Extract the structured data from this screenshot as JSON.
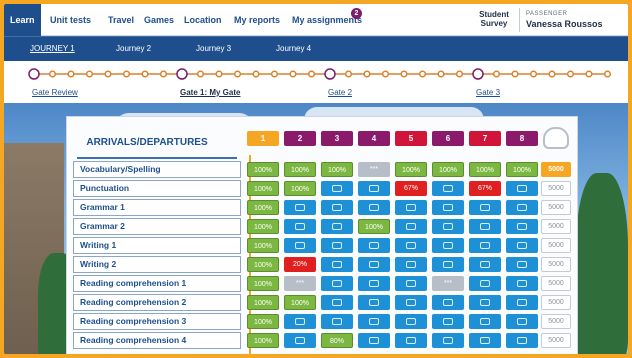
{
  "nav": {
    "tabs": [
      "Learn",
      "Unit tests",
      "Travel",
      "Games",
      "Location",
      "My reports",
      "My assignments"
    ],
    "assignments_badge": "2",
    "survey": "Student Survey",
    "passenger_label": "PASSENGER",
    "passenger_name": "Vanessa Roussos"
  },
  "journeys": [
    "JOURNEY 1",
    "Journey 2",
    "Journey 3",
    "Journey 4"
  ],
  "gates": {
    "review": "Gate Review",
    "g1": "Gate 1: My Gate",
    "g2": "Gate 2",
    "g3": "Gate 3"
  },
  "board": {
    "header": "ARRIVALS/DEPARTURES",
    "gate_numbers": [
      "1",
      "2",
      "3",
      "4",
      "5",
      "6",
      "7",
      "8"
    ],
    "gate_colors": [
      "#f5a623",
      "#8b1a6b",
      "#8b1a6b",
      "#8b1a6b",
      "#d1153a",
      "#8b1a6b",
      "#d1153a",
      "#8b1a6b"
    ],
    "rows": [
      {
        "label": "Vocabulary/Spelling",
        "cells": [
          "100%",
          "100%",
          "100%",
          "***",
          "100%",
          "100%",
          "100%",
          "100%"
        ],
        "score": "5000"
      },
      {
        "label": "Punctuation",
        "cells": [
          "100%",
          "100%",
          "plane",
          "bike",
          "67%",
          "card",
          "67%",
          "bag"
        ],
        "score": "5000"
      },
      {
        "label": "Grammar 1",
        "cells": [
          "100%",
          "wheel",
          "ticket",
          "camera",
          "bed",
          "food",
          "map",
          "shoe"
        ],
        "score": "5000"
      },
      {
        "label": "Grammar 2",
        "cells": [
          "100%",
          "bus",
          "tree",
          "100%",
          "star",
          "cake",
          "boat",
          "hand"
        ],
        "score": "5000"
      },
      {
        "label": "Writing 1",
        "cells": [
          "100%",
          "truck",
          "sign",
          "face",
          "ball",
          "hat",
          "moon",
          "cup"
        ],
        "score": "5000"
      },
      {
        "label": "Writing 2",
        "cells": [
          "100%",
          "20%",
          "car",
          "ship",
          "sail",
          "brush",
          "kite",
          "pin"
        ],
        "score": "5000"
      },
      {
        "label": "Reading comprehension 1",
        "cells": [
          "100%",
          "***",
          "drop",
          "flag",
          "van",
          "***",
          "gift",
          "cap"
        ],
        "score": "5000"
      },
      {
        "label": "Reading comprehension 2",
        "cells": [
          "100%",
          "100%",
          "link",
          "book",
          "zoom",
          "star",
          "shoe",
          "door"
        ],
        "score": "5000"
      },
      {
        "label": "Reading comprehension 3",
        "cells": [
          "100%",
          "globe",
          "image",
          "anchor",
          "pot",
          "compass",
          "feet",
          "key"
        ],
        "score": "5000"
      },
      {
        "label": "Reading comprehension 4",
        "cells": [
          "100%",
          "gear",
          "80%",
          "rocket",
          "mirror",
          "lamp",
          "jet",
          "pen"
        ],
        "score": "5000"
      }
    ]
  },
  "colors": {
    "orange": "#f5a623",
    "navy": "#1e4f8c",
    "green": "#7cb742",
    "blue": "#1e90d6",
    "red": "#e02020"
  }
}
